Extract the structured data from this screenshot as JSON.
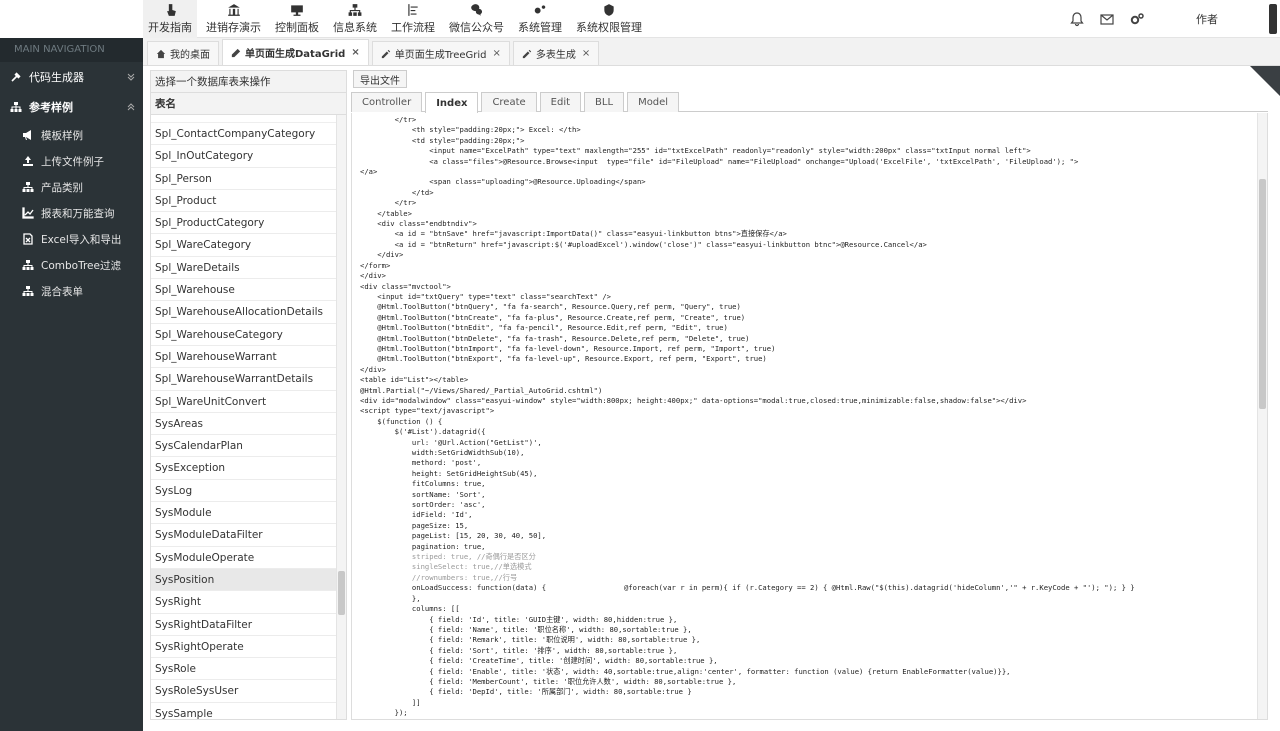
{
  "topnav": [
    {
      "label": "开发指南",
      "icon": "hand-pointer-icon",
      "active": true
    },
    {
      "label": "进销存演示",
      "icon": "bank-icon"
    },
    {
      "label": "控制面板",
      "icon": "monitor-icon"
    },
    {
      "label": "信息系统",
      "icon": "sitemap-icon"
    },
    {
      "label": "工作流程",
      "icon": "flow-icon"
    },
    {
      "label": "微信公众号",
      "icon": "wechat-icon"
    },
    {
      "label": "系统管理",
      "icon": "gears-icon"
    },
    {
      "label": "系统权限管理",
      "icon": "shield-icon"
    }
  ],
  "header": {
    "user": "作者"
  },
  "sidebar": {
    "header": "MAIN NAVIGATION",
    "groups": [
      {
        "label": "代码生成器",
        "icon": "gavel-icon"
      },
      {
        "label": "参考样例",
        "icon": "sitemap-icon"
      }
    ],
    "items": [
      {
        "label": "模板样例",
        "icon": "bullhorn-icon"
      },
      {
        "label": "上传文件例子",
        "icon": "upload-icon"
      },
      {
        "label": "产品类别",
        "icon": "sitemap-icon"
      },
      {
        "label": "报表和万能查询",
        "icon": "chart-icon"
      },
      {
        "label": "Excel导入和导出",
        "icon": "file-excel-icon"
      },
      {
        "label": "ComboTree过滤",
        "icon": "sitemap-icon"
      },
      {
        "label": "混合表单",
        "icon": "sitemap-icon"
      }
    ]
  },
  "tabs": [
    {
      "label": "我的桌面",
      "icon": "home-icon",
      "closable": false
    },
    {
      "label": "单页面生成DataGrid",
      "icon": "pencil-icon",
      "closable": true,
      "active": true
    },
    {
      "label": "单页面生成TreeGrid",
      "icon": "edit-icon",
      "closable": true
    },
    {
      "label": "多表生成",
      "icon": "edit-icon",
      "closable": true
    }
  ],
  "tab_close": "×",
  "left_panel": {
    "title": "选择一个数据库表来操作",
    "column": "表名",
    "rows": [
      "Spl_ContactCompanyCategory",
      "Spl_InOutCategory",
      "Spl_Person",
      "Spl_Product",
      "Spl_ProductCategory",
      "Spl_WareCategory",
      "Spl_WareDetails",
      "Spl_Warehouse",
      "Spl_WarehouseAllocationDetails",
      "Spl_WarehouseCategory",
      "Spl_WarehouseWarrant",
      "Spl_WarehouseWarrantDetails",
      "Spl_WareUnitConvert",
      "SysAreas",
      "SysCalendarPlan",
      "SysException",
      "SysLog",
      "SysModule",
      "SysModuleDataFilter",
      "SysModuleOperate",
      "SysPosition",
      "SysRight",
      "SysRightDataFilter",
      "SysRightOperate",
      "SysRole",
      "SysRoleSysUser",
      "SysSample"
    ],
    "selected": "SysPosition"
  },
  "editor": {
    "export_label": "导出文件",
    "tabs": [
      "Controller",
      "Index",
      "Create",
      "Edit",
      "BLL",
      "Model"
    ],
    "active_tab": "Index",
    "code": [
      "        </tr>",
      "            <th style=\"padding:20px;\"> Excel: </th>",
      "            <td style=\"padding:20px;\">",
      "                <input name=\"ExcelPath\" type=\"text\" maxlength=\"255\" id=\"txtExcelPath\" readonly=\"readonly\" style=\"width:200px\" class=\"txtInput normal left\">",
      "                <a class=\"files\">@Resource.Browse<input  type=\"file\" id=\"FileUpload\" name=\"FileUpload\" onchange=\"Upload('ExcelFile', 'txtExcelPath', 'FileUpload'); \">",
      "</a>",
      "                <span class=\"uploading\">@Resource.Uploading</span>",
      "            </td>",
      "        </tr>",
      "    </table>",
      "    <div class=\"endbtndiv\">",
      "        <a id = \"btnSave\" href=\"javascript:ImportData()\" class=\"easyui-linkbutton btns\">直接保存</a>",
      "        <a id = \"btnReturn\" href=\"javascript:$('#uploadExcel').window('close')\" class=\"easyui-linkbutton btnc\">@Resource.Cancel</a>",
      "    </div>",
      "</form>",
      "</div>",
      "<div class=\"mvctool\">",
      "    <input id=\"txtQuery\" type=\"text\" class=\"searchText\" />",
      "    @Html.ToolButton(\"btnQuery\", \"fa fa-search\", Resource.Query,ref perm, \"Query\", true)",
      "    @Html.ToolButton(\"btnCreate\", \"fa fa-plus\", Resource.Create,ref perm, \"Create\", true)",
      "    @Html.ToolButton(\"btnEdit\", \"fa fa-pencil\", Resource.Edit,ref perm, \"Edit\", true)",
      "    @Html.ToolButton(\"btnDelete\", \"fa fa-trash\", Resource.Delete,ref perm, \"Delete\", true)",
      "    @Html.ToolButton(\"btnImport\", \"fa fa-level-down\", Resource.Import, ref perm, \"Import\", true)",
      "    @Html.ToolButton(\"btnExport\", \"fa fa-level-up\", Resource.Export, ref perm, \"Export\", true)",
      "</div>",
      "<table id=\"List\"></table>",
      "@Html.Partial(\"~/Views/Shared/_Partial_AutoGrid.cshtml\")",
      "",
      "<div id=\"modalwindow\" class=\"easyui-window\" style=\"width:800px; height:400px;\" data-options=\"modal:true,closed:true,minimizable:false,shadow:false\"></div>",
      "<script type=\"text/javascript\">",
      "    $(function () {",
      "        $('#List').datagrid({",
      "            url: '@Url.Action(\"GetList\")',",
      "            width:SetGridWidthSub(10),",
      "            methord: 'post',",
      "            height: SetGridHeightSub(45),",
      "            fitColumns: true,",
      "            sortName: 'Sort',",
      "            sortOrder: 'asc',",
      "            idField: 'Id',",
      "            pageSize: 15,",
      "            pageList: [15, 20, 30, 40, 50],",
      "            pagination: true,",
      "            striped: true, //奇偶行是否区分",
      "            singleSelect: true,//单选模式",
      "            //rownumbers: true,//行号",
      "            onLoadSuccess: function(data) {                  @foreach(var r in perm){ if (r.Category == 2) { @Html.Raw(\"$(this).datagrid('hideColumn','\" + r.KeyCode + \"'); \"); } }",
      "            },",
      "            columns: [[",
      "                { field: 'Id', title: 'GUID主键', width: 80,hidden:true },",
      "                { field: 'Name', title: '职位名称', width: 80,sortable:true },",
      "                { field: 'Remark', title: '职位说明', width: 80,sortable:true },",
      "                { field: 'Sort', title: '排序', width: 80,sortable:true },",
      "                { field: 'CreateTime', title: '创建时间', width: 80,sortable:true },",
      "                { field: 'Enable', title: '状态', width: 40,sortable:true,align:'center', formatter: function (value) {return EnableFormatter(value)}},",
      "                { field: 'MemberCount', title: '职位允许人数', width: 80,sortable:true },",
      "                { field: 'DepId', title: '所属部门', width: 80,sortable:true }",
      "            ]]",
      "        });"
    ]
  }
}
